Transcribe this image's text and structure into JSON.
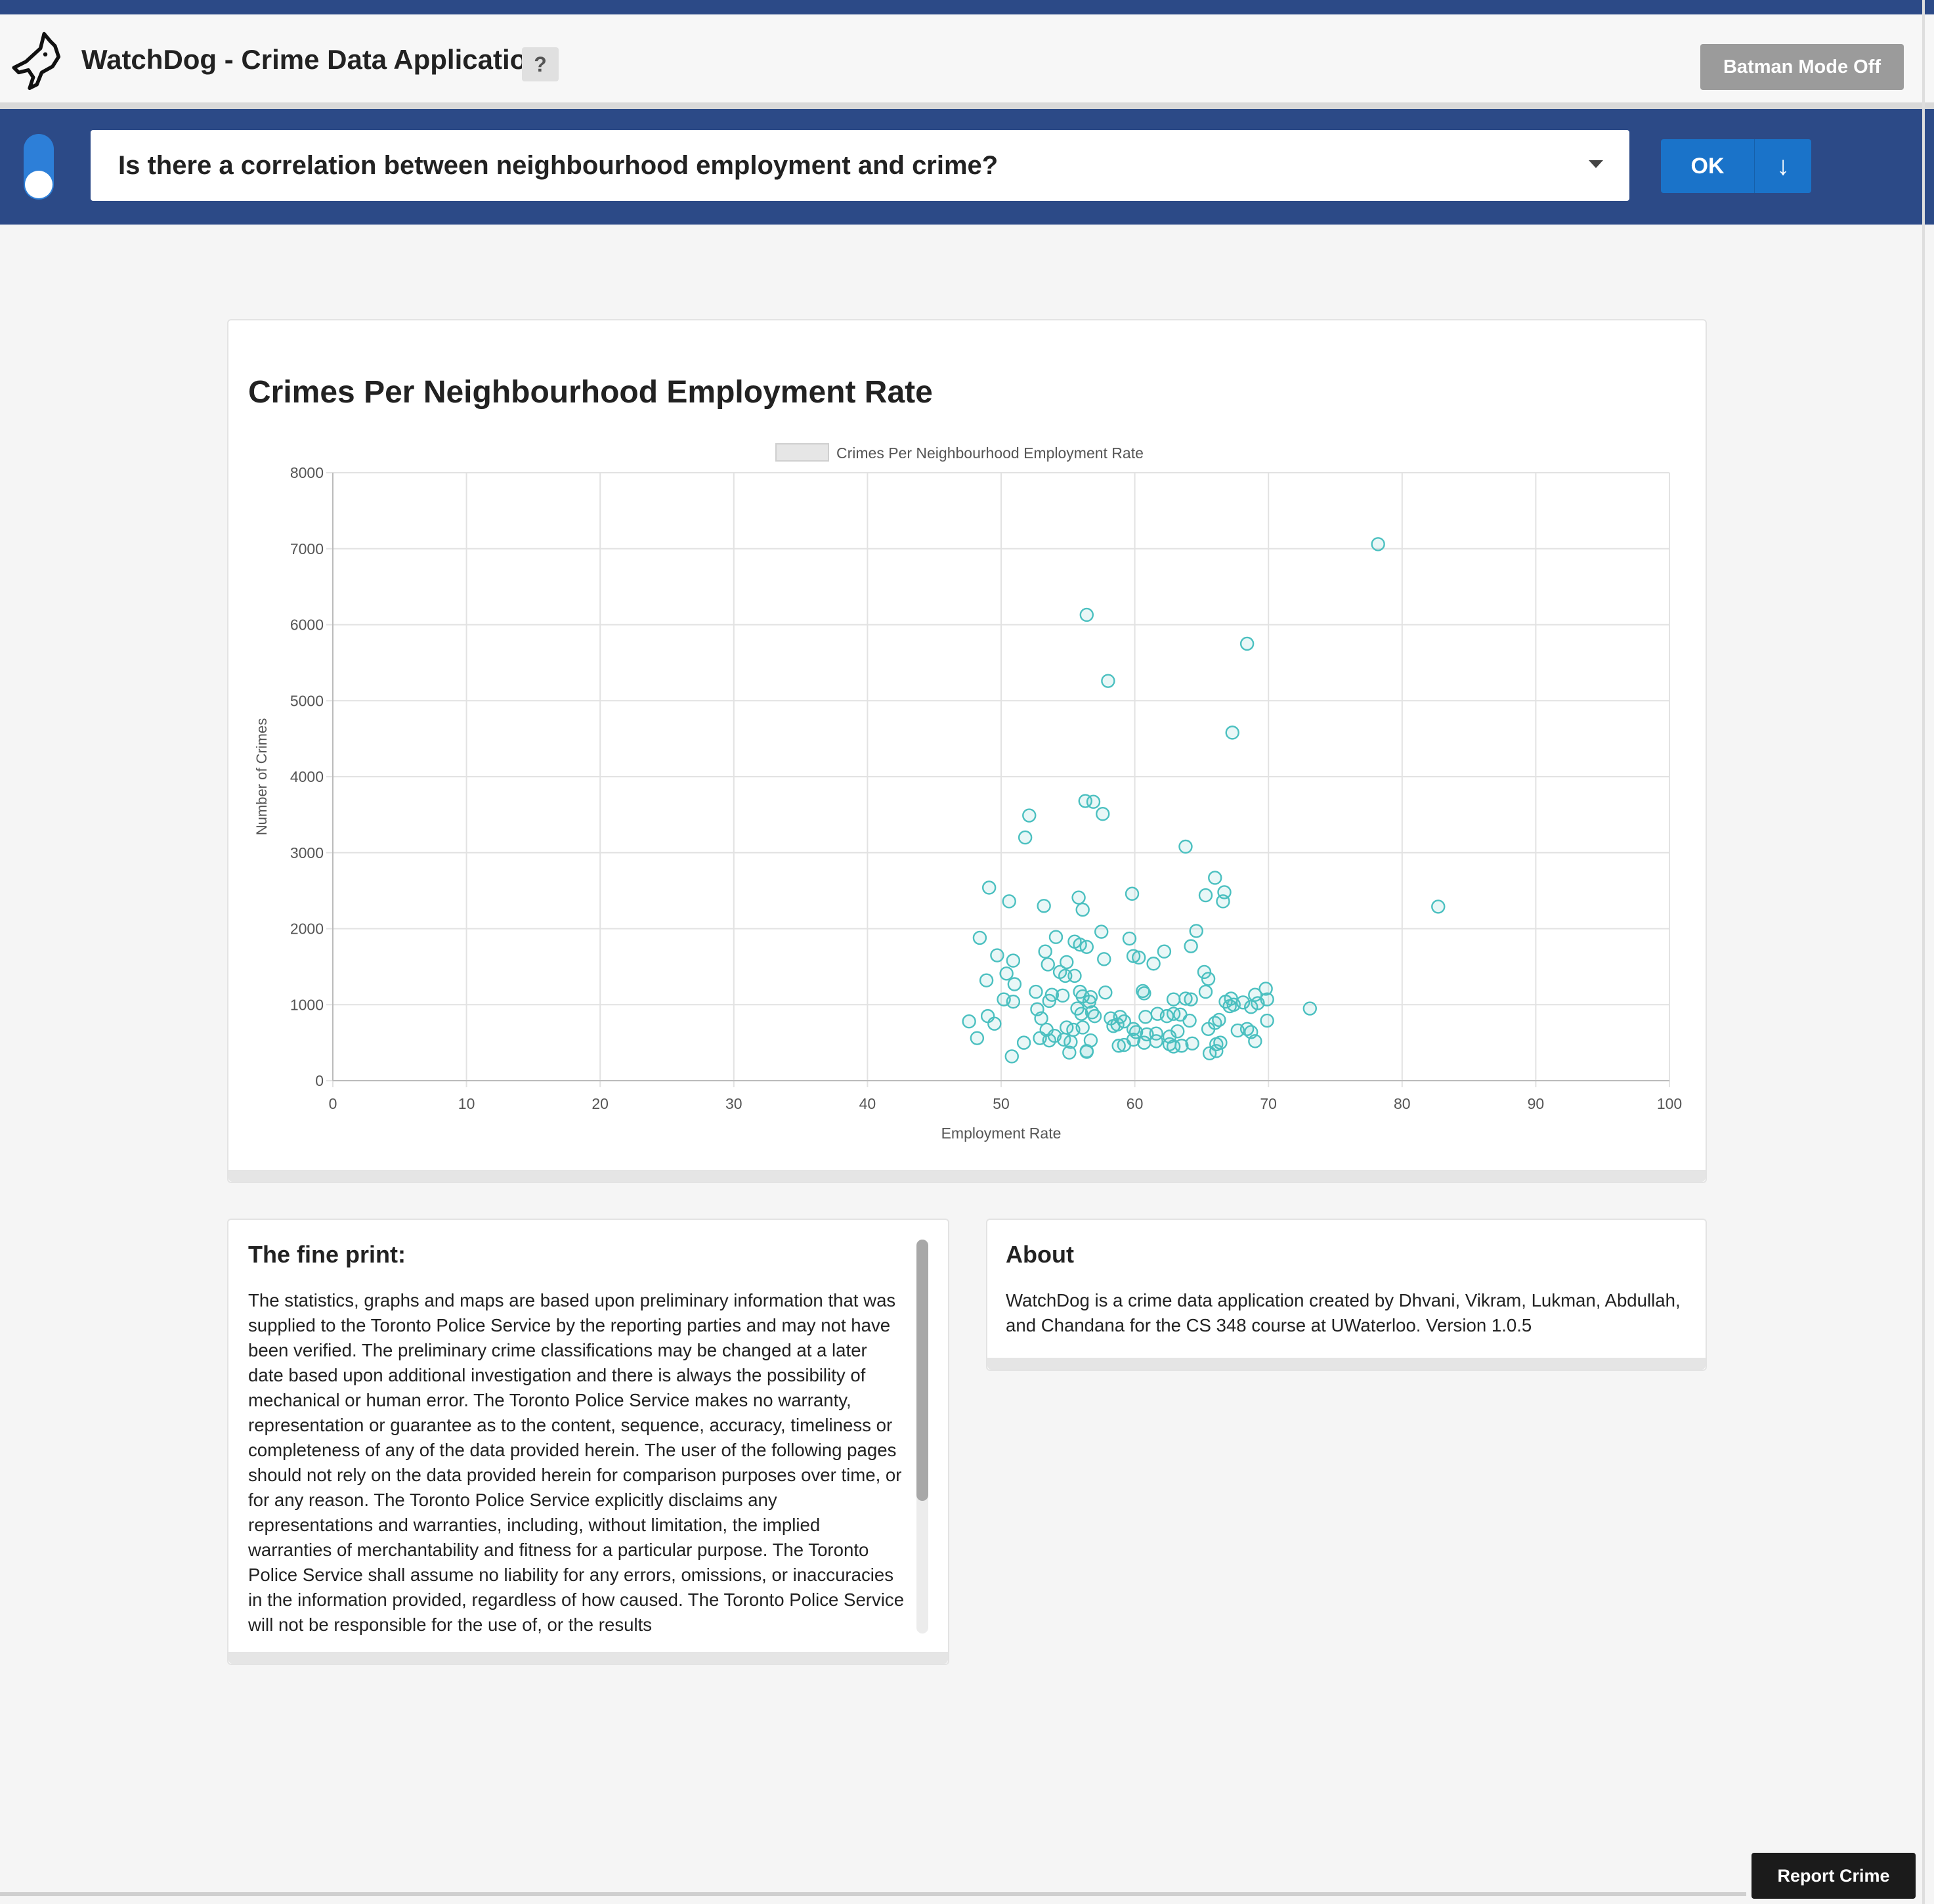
{
  "app": {
    "title": "WatchDog - Crime Data Application",
    "help_label": "?",
    "batman_label": "Batman Mode Off"
  },
  "question": {
    "selected": "Is there a correlation between neighbourhood employment and crime?",
    "ok_label": "OK",
    "download_icon": "↓"
  },
  "colors": {
    "accent": "#2c4a87",
    "button_blue": "#1a73c9",
    "point": "#4bc0c0"
  },
  "chart": {
    "title": "Crimes Per Neighbourhood Employment Rate",
    "legend": "Crimes Per Neighbourhood Employment Rate",
    "xlabel": "Employment Rate",
    "ylabel": "Number of Crimes"
  },
  "chart_data": {
    "type": "scatter",
    "title": "Crimes Per Neighbourhood Employment Rate",
    "xlabel": "Employment Rate",
    "ylabel": "Number of Crimes",
    "xlim": [
      0,
      100
    ],
    "ylim": [
      0,
      8000
    ],
    "x_ticks": [
      0,
      10,
      20,
      30,
      40,
      50,
      60,
      70,
      80,
      90,
      100
    ],
    "y_ticks": [
      0,
      1000,
      2000,
      3000,
      4000,
      5000,
      6000,
      7000,
      8000
    ],
    "grid": true,
    "legend_position": "top",
    "series": [
      {
        "name": "Crimes Per Neighbourhood Employment Rate",
        "points": [
          [
            78.2,
            7060
          ],
          [
            56.4,
            6130
          ],
          [
            68.4,
            5750
          ],
          [
            58.0,
            5260
          ],
          [
            67.3,
            4580
          ],
          [
            56.3,
            3680
          ],
          [
            56.9,
            3670
          ],
          [
            57.6,
            3510
          ],
          [
            52.1,
            3490
          ],
          [
            51.8,
            3200
          ],
          [
            63.8,
            3080
          ],
          [
            66.0,
            2670
          ],
          [
            66.7,
            2480
          ],
          [
            49.1,
            2540
          ],
          [
            59.8,
            2460
          ],
          [
            65.3,
            2440
          ],
          [
            55.8,
            2410
          ],
          [
            50.6,
            2360
          ],
          [
            53.2,
            2300
          ],
          [
            66.6,
            2360
          ],
          [
            82.7,
            2290
          ],
          [
            56.1,
            2250
          ],
          [
            57.5,
            1960
          ],
          [
            64.6,
            1970
          ],
          [
            48.4,
            1880
          ],
          [
            54.1,
            1890
          ],
          [
            59.6,
            1870
          ],
          [
            55.5,
            1830
          ],
          [
            55.9,
            1790
          ],
          [
            56.4,
            1760
          ],
          [
            64.2,
            1770
          ],
          [
            62.2,
            1700
          ],
          [
            53.3,
            1700
          ],
          [
            59.9,
            1640
          ],
          [
            60.3,
            1620
          ],
          [
            49.7,
            1650
          ],
          [
            50.9,
            1580
          ],
          [
            57.7,
            1600
          ],
          [
            61.4,
            1540
          ],
          [
            53.5,
            1530
          ],
          [
            54.9,
            1560
          ],
          [
            54.4,
            1430
          ],
          [
            54.8,
            1380
          ],
          [
            55.5,
            1380
          ],
          [
            65.2,
            1430
          ],
          [
            50.4,
            1410
          ],
          [
            65.5,
            1340
          ],
          [
            48.9,
            1320
          ],
          [
            51.0,
            1270
          ],
          [
            52.6,
            1170
          ],
          [
            53.8,
            1130
          ],
          [
            54.6,
            1120
          ],
          [
            55.9,
            1170
          ],
          [
            56.1,
            1110
          ],
          [
            56.7,
            1100
          ],
          [
            57.8,
            1160
          ],
          [
            60.6,
            1180
          ],
          [
            60.7,
            1150
          ],
          [
            62.9,
            1070
          ],
          [
            63.8,
            1080
          ],
          [
            64.2,
            1070
          ],
          [
            65.3,
            1170
          ],
          [
            66.8,
            1040
          ],
          [
            67.2,
            1080
          ],
          [
            68.1,
            1030
          ],
          [
            69.0,
            1130
          ],
          [
            69.8,
            1210
          ],
          [
            69.9,
            1070
          ],
          [
            50.2,
            1070
          ],
          [
            50.9,
            1040
          ],
          [
            53.6,
            1050
          ],
          [
            52.7,
            940
          ],
          [
            53.0,
            820
          ],
          [
            55.7,
            950
          ],
          [
            56.0,
            880
          ],
          [
            56.6,
            1040
          ],
          [
            56.8,
            900
          ],
          [
            57.0,
            850
          ],
          [
            58.2,
            820
          ],
          [
            58.9,
            840
          ],
          [
            59.2,
            780
          ],
          [
            60.8,
            840
          ],
          [
            61.7,
            880
          ],
          [
            62.4,
            850
          ],
          [
            62.9,
            880
          ],
          [
            63.4,
            870
          ],
          [
            64.1,
            790
          ],
          [
            66.0,
            760
          ],
          [
            66.3,
            800
          ],
          [
            67.1,
            980
          ],
          [
            67.4,
            1000
          ],
          [
            68.7,
            970
          ],
          [
            69.2,
            1020
          ],
          [
            73.1,
            950
          ],
          [
            47.6,
            780
          ],
          [
            49.0,
            850
          ],
          [
            49.5,
            750
          ],
          [
            53.4,
            670
          ],
          [
            54.0,
            590
          ],
          [
            54.9,
            700
          ],
          [
            55.4,
            670
          ],
          [
            56.1,
            700
          ],
          [
            58.4,
            720
          ],
          [
            58.7,
            740
          ],
          [
            59.9,
            680
          ],
          [
            60.1,
            640
          ],
          [
            60.9,
            610
          ],
          [
            61.6,
            620
          ],
          [
            62.6,
            580
          ],
          [
            63.2,
            650
          ],
          [
            65.5,
            680
          ],
          [
            67.7,
            660
          ],
          [
            68.4,
            680
          ],
          [
            68.7,
            640
          ],
          [
            69.9,
            790
          ],
          [
            48.2,
            560
          ],
          [
            51.7,
            500
          ],
          [
            52.9,
            560
          ],
          [
            53.6,
            530
          ],
          [
            54.7,
            540
          ],
          [
            55.2,
            510
          ],
          [
            56.7,
            530
          ],
          [
            58.8,
            460
          ],
          [
            59.2,
            470
          ],
          [
            59.9,
            540
          ],
          [
            60.7,
            500
          ],
          [
            61.6,
            520
          ],
          [
            62.6,
            480
          ],
          [
            62.9,
            450
          ],
          [
            63.5,
            460
          ],
          [
            64.3,
            490
          ],
          [
            66.1,
            480
          ],
          [
            66.4,
            500
          ],
          [
            69.0,
            520
          ],
          [
            50.8,
            320
          ],
          [
            55.1,
            370
          ],
          [
            56.4,
            380
          ],
          [
            56.4,
            390
          ],
          [
            65.6,
            360
          ],
          [
            66.1,
            390
          ]
        ]
      }
    ]
  },
  "fine_print": {
    "title": "The fine print:",
    "text": "The statistics, graphs and maps are based upon preliminary information that was supplied to the Toronto Police Service by the reporting parties and may not have been verified. The preliminary crime classifications may be changed at a later date based upon additional investigation and there is always the possibility of mechanical or human error. The Toronto Police Service makes no warranty, representation or guarantee as to the content, sequence, accuracy, timeliness or completeness of any of the data provided herein. The user of the following pages should not rely on the data provided herein for comparison purposes over time, or for any reason. The Toronto Police Service explicitly disclaims any representations and warranties, including, without limitation, the implied warranties of merchantability and fitness for a particular purpose. The Toronto Police Service shall assume no liability for any errors, omissions, or inaccuracies in the information provided, regardless of how caused. The Toronto Police Service will not be responsible for the use of, or the results"
  },
  "about": {
    "title": "About",
    "text": "WatchDog is a crime data application created by Dhvani, Vikram, Lukman, Abdullah, and Chandana for the CS 348 course at UWaterloo. Version 1.0.5"
  },
  "report_label": "Report Crime"
}
